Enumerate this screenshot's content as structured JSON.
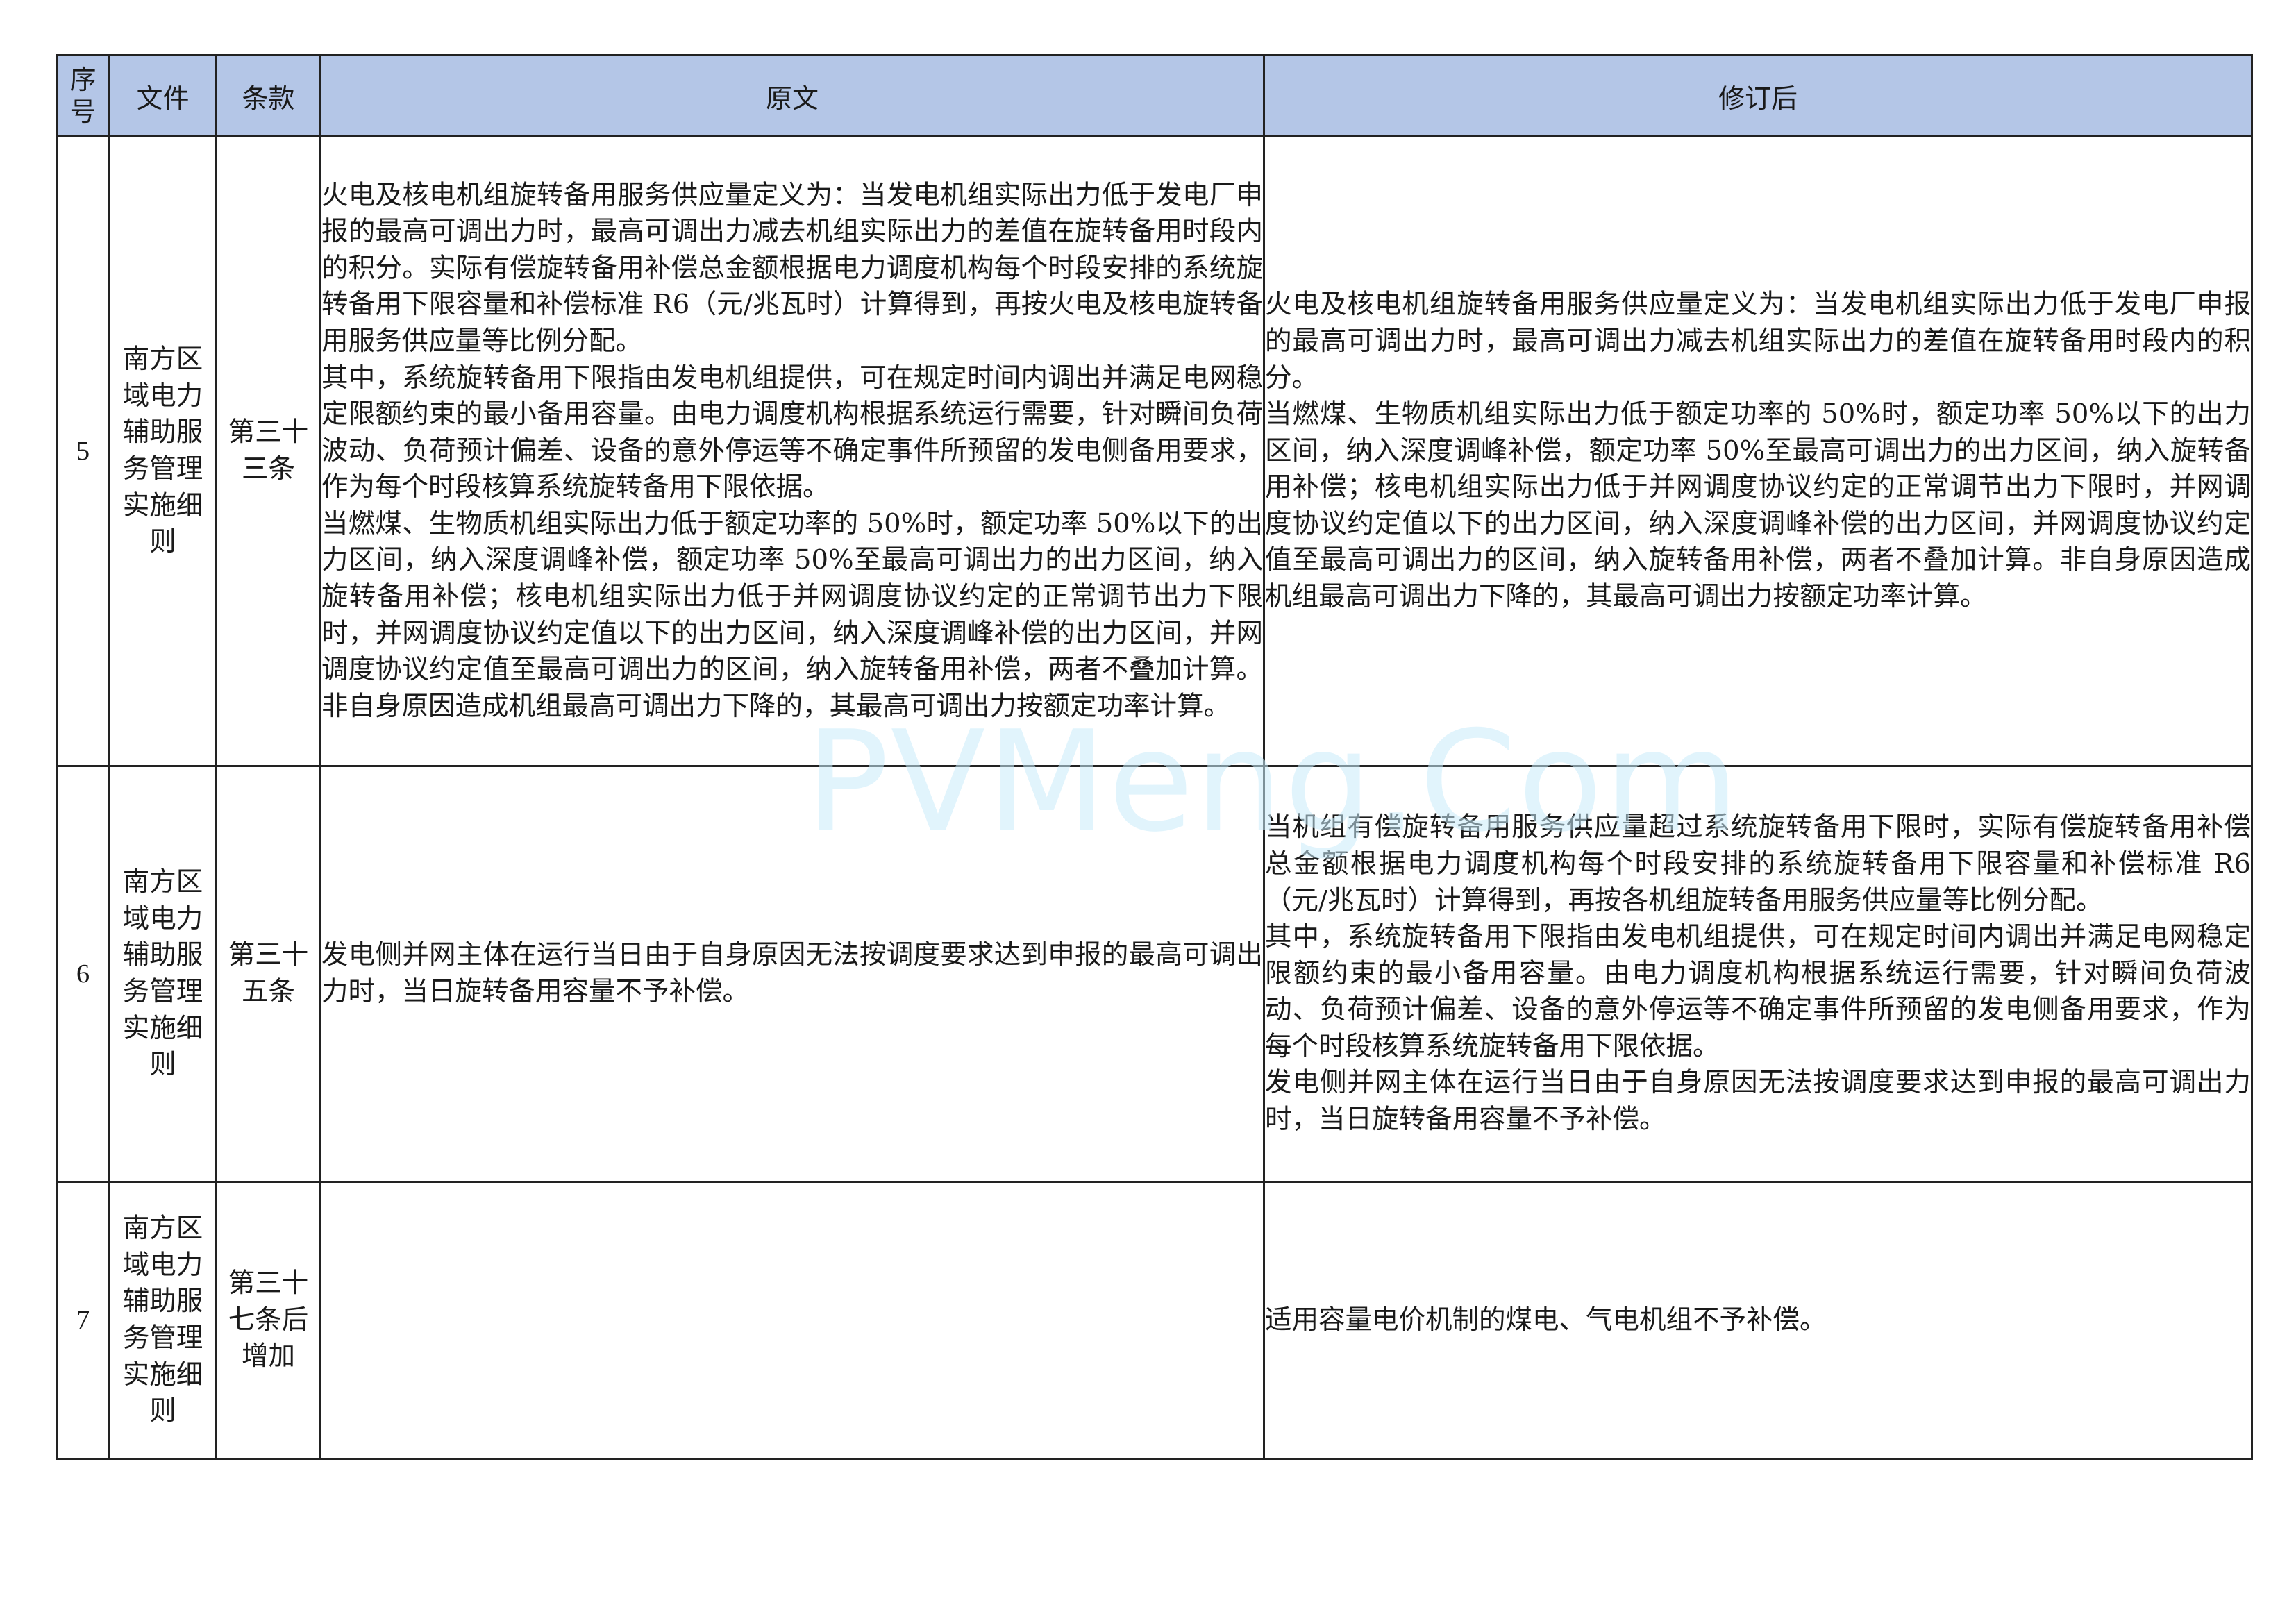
{
  "headers": {
    "seq": "序号",
    "file": "文件",
    "clause": "条款",
    "original": "原文",
    "revised": "修订后"
  },
  "rows": [
    {
      "seq": "5",
      "file": "南方区域电力辅助服务管理实施细则",
      "clause": "第三十三条",
      "original": [
        "火电及核电机组旋转备用服务供应量定义为：当发电机组实际出力低于发电厂申报的最高可调出力时，最高可调出力减去机组实际出力的差值在旋转备用时段内的积分。实际有偿旋转备用补偿总金额根据电力调度机构每个时段安排的系统旋转备用下限容量和补偿标准 R6（元/兆瓦时）计算得到，再按火电及核电旋转备用服务供应量等比例分配。",
        "其中，系统旋转备用下限指由发电机组提供，可在规定时间内调出并满足电网稳定限额约束的最小备用容量。由电力调度机构根据系统运行需要，针对瞬间负荷波动、负荷预计偏差、设备的意外停运等不确定事件所预留的发电侧备用要求，作为每个时段核算系统旋转备用下限依据。",
        "当燃煤、生物质机组实际出力低于额定功率的 50%时，额定功率 50%以下的出力区间，纳入深度调峰补偿，额定功率 50%至最高可调出力的出力区间，纳入旋转备用补偿；核电机组实际出力低于并网调度协议约定的正常调节出力下限时，并网调度协议约定值以下的出力区间，纳入深度调峰补偿的出力区间，并网调度协议约定值至最高可调出力的区间，纳入旋转备用补偿，两者不叠加计算。非自身原因造成机组最高可调出力下降的，其最高可调出力按额定功率计算。"
      ],
      "revised": [
        "火电及核电机组旋转备用服务供应量定义为：当发电机组实际出力低于发电厂申报的最高可调出力时，最高可调出力减去机组实际出力的差值在旋转备用时段内的积分。",
        "当燃煤、生物质机组实际出力低于额定功率的 50%时，额定功率 50%以下的出力区间，纳入深度调峰补偿，额定功率 50%至最高可调出力的出力区间，纳入旋转备用补偿；核电机组实际出力低于并网调度协议约定的正常调节出力下限时，并网调度协议约定值以下的出力区间，纳入深度调峰补偿的出力区间，并网调度协议约定值至最高可调出力的区间，纳入旋转备用补偿，两者不叠加计算。非自身原因造成机组最高可调出力下降的，其最高可调出力按额定功率计算。"
      ]
    },
    {
      "seq": "6",
      "file": "南方区域电力辅助服务管理实施细则",
      "clause": "第三十五条",
      "original": [
        "发电侧并网主体在运行当日由于自身原因无法按调度要求达到申报的最高可调出力时，当日旋转备用容量不予补偿。"
      ],
      "revised": [
        "当机组有偿旋转备用服务供应量超过系统旋转备用下限时，实际有偿旋转备用补偿总金额根据电力调度机构每个时段安排的系统旋转备用下限容量和补偿标准 R6（元/兆瓦时）计算得到，再按各机组旋转备用服务供应量等比例分配。",
        "其中，系统旋转备用下限指由发电机组提供，可在规定时间内调出并满足电网稳定限额约束的最小备用容量。由电力调度机构根据系统运行需要，针对瞬间负荷波动、负荷预计偏差、设备的意外停运等不确定事件所预留的发电侧备用要求，作为每个时段核算系统旋转备用下限依据。",
        "发电侧并网主体在运行当日由于自身原因无法按调度要求达到申报的最高可调出力时，当日旋转备用容量不予补偿。"
      ]
    },
    {
      "seq": "7",
      "file": "南方区域电力辅助服务管理实施细则",
      "clause": "第三十七条后增加",
      "original": [],
      "revised": [
        "适用容量电价机制的煤电、气电机组不予补偿。"
      ]
    }
  ],
  "watermark": "PVMeng.Com",
  "colors": {
    "header_bg": "#b4c6e7",
    "border": "#222222",
    "watermark": "#c9ecfb"
  }
}
